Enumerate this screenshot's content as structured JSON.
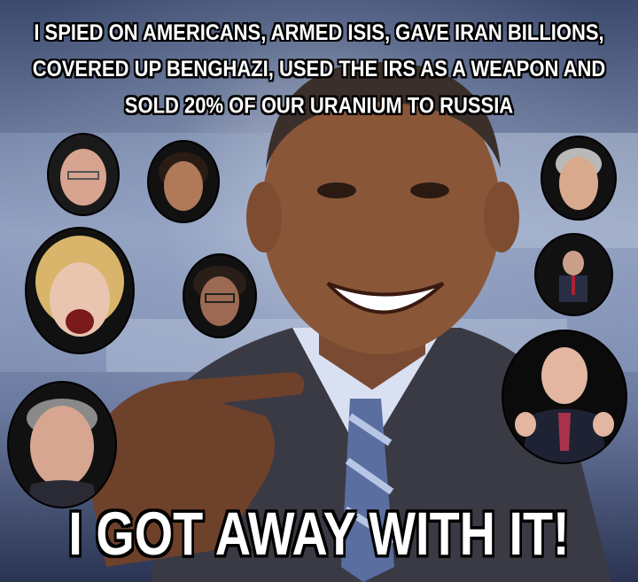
{
  "meme": {
    "top_caption": "I SPIED ON AMERICANS, ARMED ISIS, GAVE IRAN BILLIONS, COVERED UP BENGHAZI, USED THE IRS AS A WEAPON AND SOLD 20% OF OUR URANIUM TO RUSSIA",
    "bottom_caption": "I GOT AWAY WITH IT!",
    "caption_color": "#ffffff",
    "outline_color": "#000000"
  }
}
